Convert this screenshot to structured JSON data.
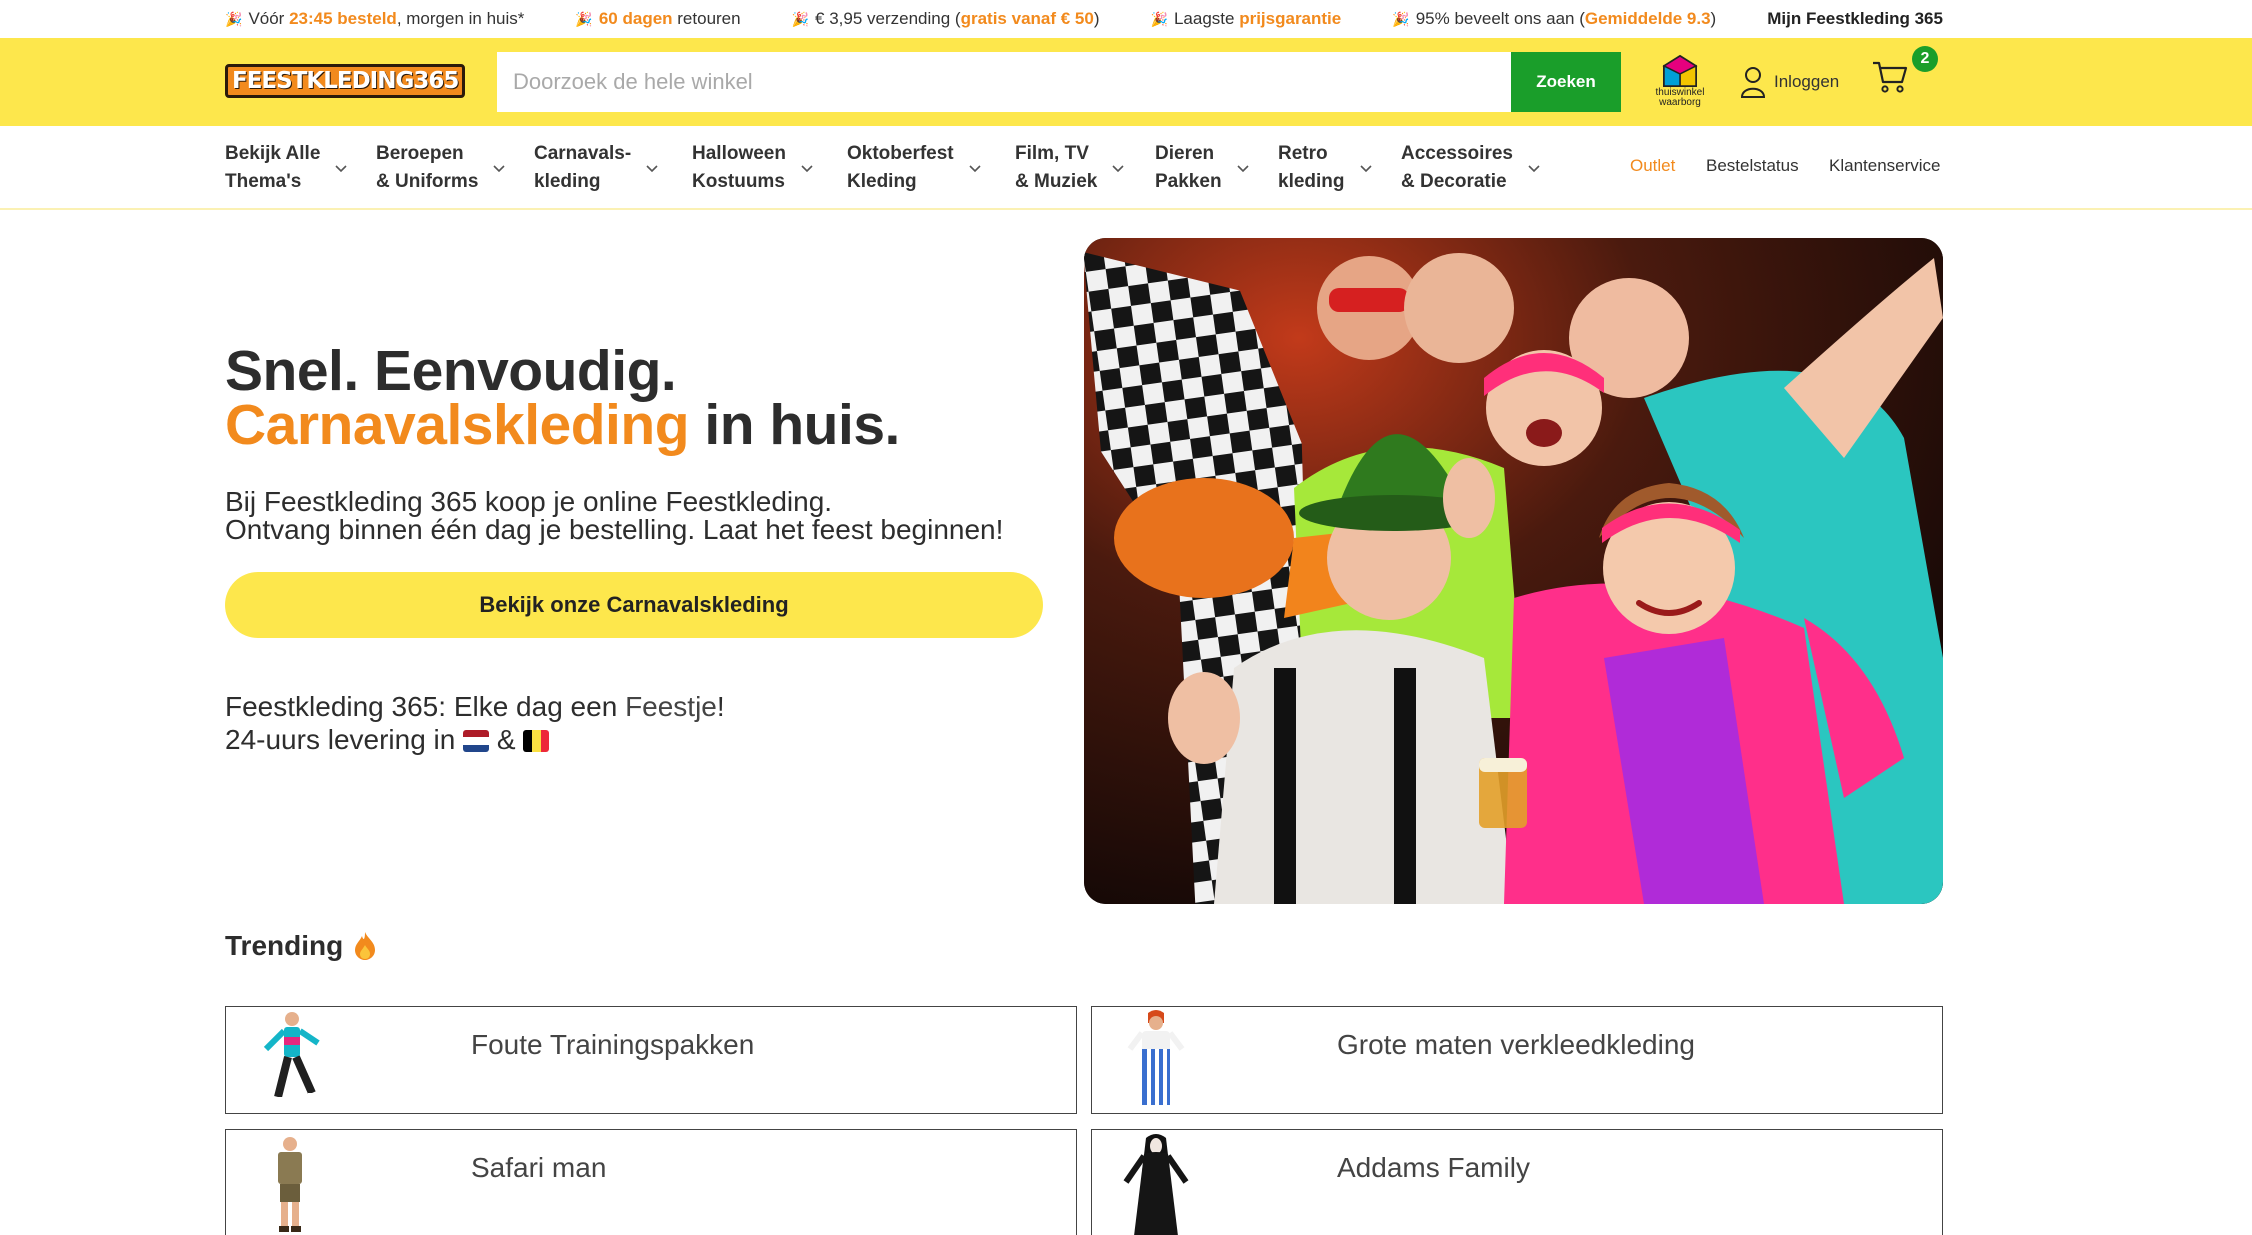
{
  "usp": {
    "items": [
      {
        "pre": "Vóór ",
        "hl": "23:45 besteld",
        "post": ", morgen in huis*"
      },
      {
        "pre": "",
        "hl": "60 dagen",
        "post": " retouren"
      },
      {
        "pre": "€ 3,95 verzending (",
        "hl": "gratis vanaf € 50",
        "post": ")"
      },
      {
        "pre": "Laagste ",
        "hl": "prijsgarantie",
        "post": ""
      },
      {
        "pre": "95% beveelt ons aan (",
        "hl": "Gemiddelde 9.3",
        "post": ")"
      }
    ],
    "account": "Mijn Feestkleding 365"
  },
  "header": {
    "logo": "FEESTKLEDING365",
    "search_placeholder": "Doorzoek de hele winkel",
    "search_button": "Zoeken",
    "waarborg_line1": "thuiswinkel",
    "waarborg_line2": "waarborg",
    "login": "Inloggen",
    "cart_count": "2"
  },
  "nav": {
    "items": [
      "Bekijk Alle\nThema's",
      "Beroepen\n& Uniforms",
      "Carnavals-\nkleding",
      "Halloween\nKostuums",
      "Oktoberfest\nKleding",
      "Film, TV\n& Muziek",
      "Dieren\nPakken",
      "Retro\nkleding",
      "Accessoires\n& Decoratie"
    ],
    "outlet": "Outlet",
    "order_status": "Bestelstatus",
    "customer_service": "Klantenservice"
  },
  "hero": {
    "line1": "Snel. Eenvoudig.",
    "line2_orange": "Carnavalskleding",
    "line2_rest": " in huis.",
    "sub1": "Bij Feestkleding 365 koop je online Feestkleding.",
    "sub2": "Ontvang binnen één dag je bestelling. Laat het feest beginnen!",
    "cta": "Bekijk onze Carnavalskleding",
    "tag1_pre": "Feestkleding 365: Elke dag een ",
    "tag1_link": "Feestje",
    "tag1_post": "!",
    "tag2_pre": "24-uurs levering in ",
    "tag2_amp": " & "
  },
  "trending": {
    "title": "Trending",
    "cards": [
      "Foute Trainingspakken",
      "Grote maten verkleedkleding",
      "Safari man",
      "Addams Family"
    ]
  },
  "colors": {
    "brand_yellow": "#fde74c",
    "accent_orange": "#f28a1d",
    "search_green": "#1a9e2a"
  }
}
